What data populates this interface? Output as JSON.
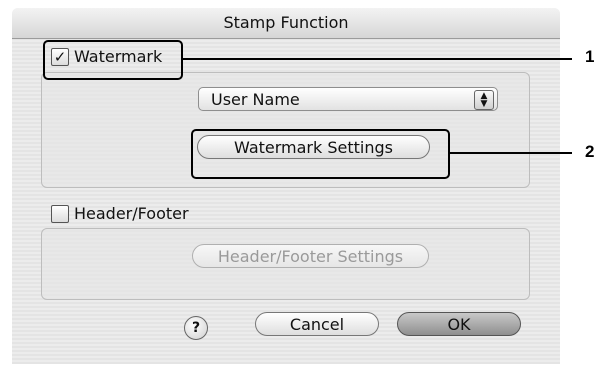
{
  "dialog": {
    "title": "Stamp Function"
  },
  "watermark": {
    "label": "Watermark",
    "checked": true,
    "checkmark": "✓",
    "select_value": "User Name",
    "settings_button": "Watermark Settings"
  },
  "header_footer": {
    "label": "Header/Footer",
    "checked": false,
    "settings_button": "Header/Footer Settings"
  },
  "footer": {
    "help": "?",
    "cancel": "Cancel",
    "ok": "OK"
  },
  "callouts": [
    "1",
    "2"
  ]
}
